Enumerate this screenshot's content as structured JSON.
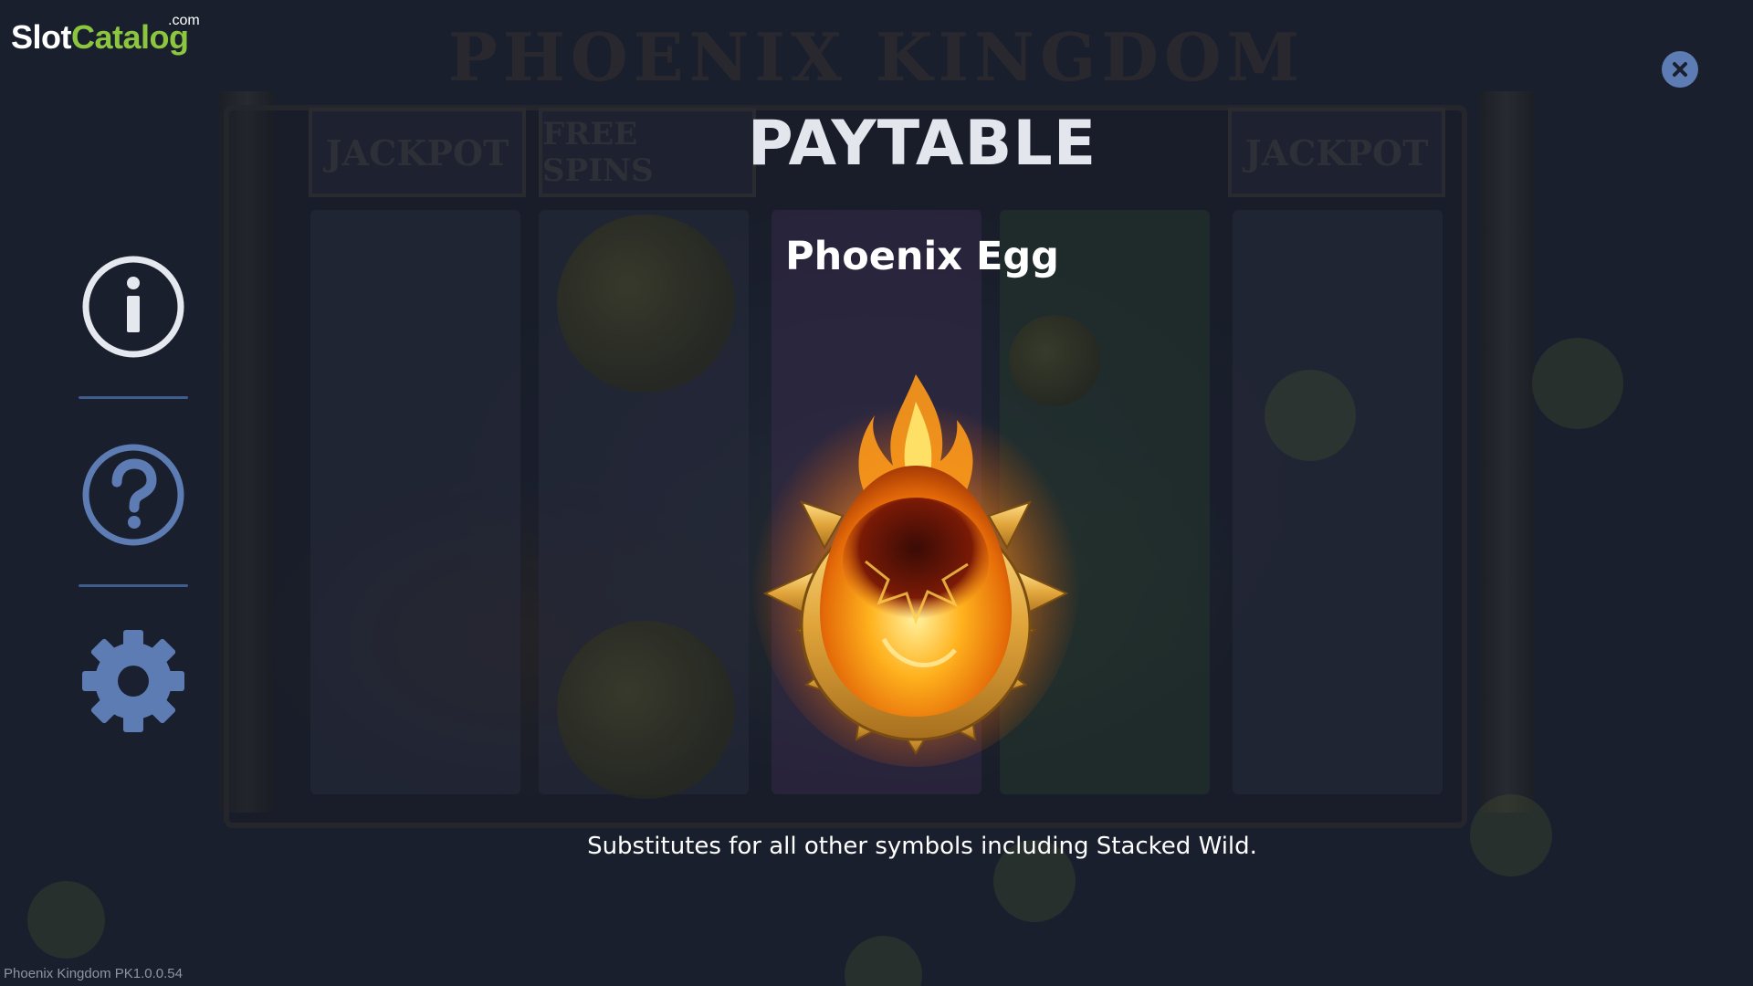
{
  "app": {
    "brand_slot": "Slot",
    "brand_catalog": "Catalog",
    "brand_tld": ".com",
    "version": "Phoenix Kingdom PK1.0.0.54"
  },
  "background": {
    "game_title": "PHOENIX KINGDOM",
    "badges": [
      "JACKPOT",
      "FREE SPINS",
      "JACKPOT"
    ]
  },
  "menu": {
    "items": [
      {
        "name": "info",
        "icon": "info-icon"
      },
      {
        "name": "help",
        "icon": "question-icon"
      },
      {
        "name": "settings",
        "icon": "gear-icon"
      }
    ]
  },
  "paytable": {
    "title": "PAYTABLE",
    "symbol_name": "Phoenix Egg",
    "symbol_icon": "phoenix-egg-icon",
    "description": "Substitutes for all other symbols including Stacked Wild."
  },
  "colors": {
    "background": "#1b2030",
    "menu_icon": "#5e7cb4",
    "info_icon": "#e6e8f0",
    "brand_green": "#8cc63f"
  }
}
